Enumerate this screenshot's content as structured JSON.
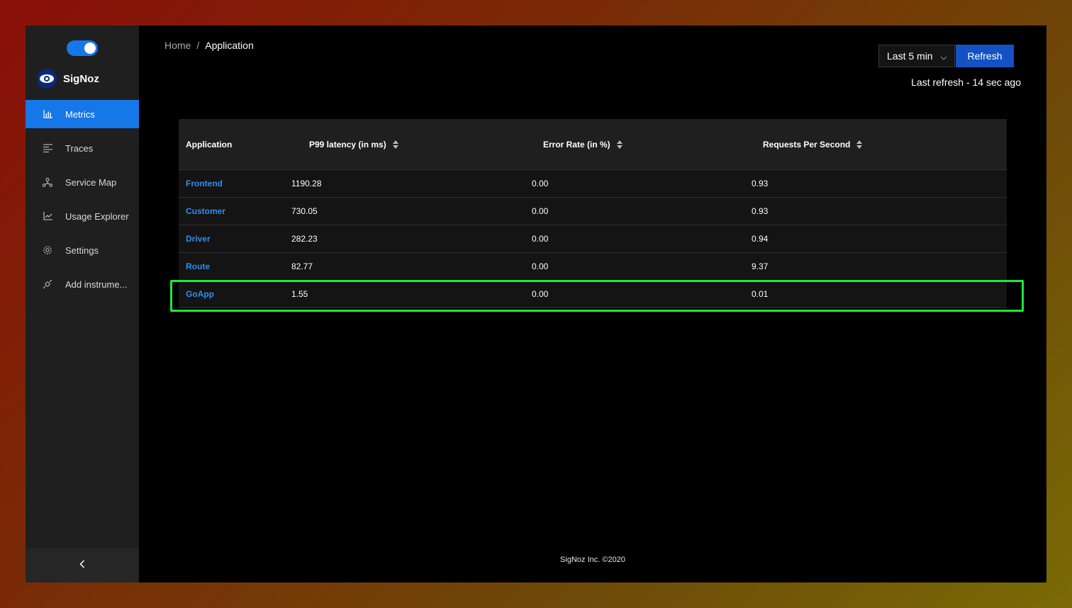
{
  "sidebar": {
    "brand": "SigNoz",
    "items": [
      {
        "label": "Metrics",
        "icon": "bar-chart-icon",
        "active": true
      },
      {
        "label": "Traces",
        "icon": "align-left-icon",
        "active": false
      },
      {
        "label": "Service Map",
        "icon": "deployment-unit-icon",
        "active": false
      },
      {
        "label": "Usage Explorer",
        "icon": "line-chart-icon",
        "active": false
      },
      {
        "label": "Settings",
        "icon": "gear-icon",
        "active": false
      },
      {
        "label": "Add instrume...",
        "icon": "api-icon",
        "active": false
      }
    ],
    "collapse_icon": "chevron-left-icon"
  },
  "breadcrumb": {
    "home": "Home",
    "separator": "/",
    "current": "Application"
  },
  "toolbar": {
    "time_range": "Last 5 min",
    "refresh_label": "Refresh",
    "last_refresh": "Last refresh - 14 sec ago"
  },
  "table": {
    "headers": {
      "application": "Application",
      "p99": "P99 latency (in ms)",
      "error_rate": "Error Rate (in %)",
      "rps": "Requests Per Second"
    },
    "rows": [
      {
        "application": "Frontend",
        "p99": "1190.28",
        "error_rate": "0.00",
        "rps": "0.93"
      },
      {
        "application": "Customer",
        "p99": "730.05",
        "error_rate": "0.00",
        "rps": "0.93"
      },
      {
        "application": "Driver",
        "p99": "282.23",
        "error_rate": "0.00",
        "rps": "0.94"
      },
      {
        "application": "Route",
        "p99": "82.77",
        "error_rate": "0.00",
        "rps": "9.37"
      },
      {
        "application": "GoApp",
        "p99": "1.55",
        "error_rate": "0.00",
        "rps": "0.01"
      }
    ]
  },
  "footer": "SigNoz Inc. ©2020",
  "colors": {
    "accent": "#1677e8",
    "link": "#2f8cf0",
    "highlight": "#1ee83a"
  }
}
